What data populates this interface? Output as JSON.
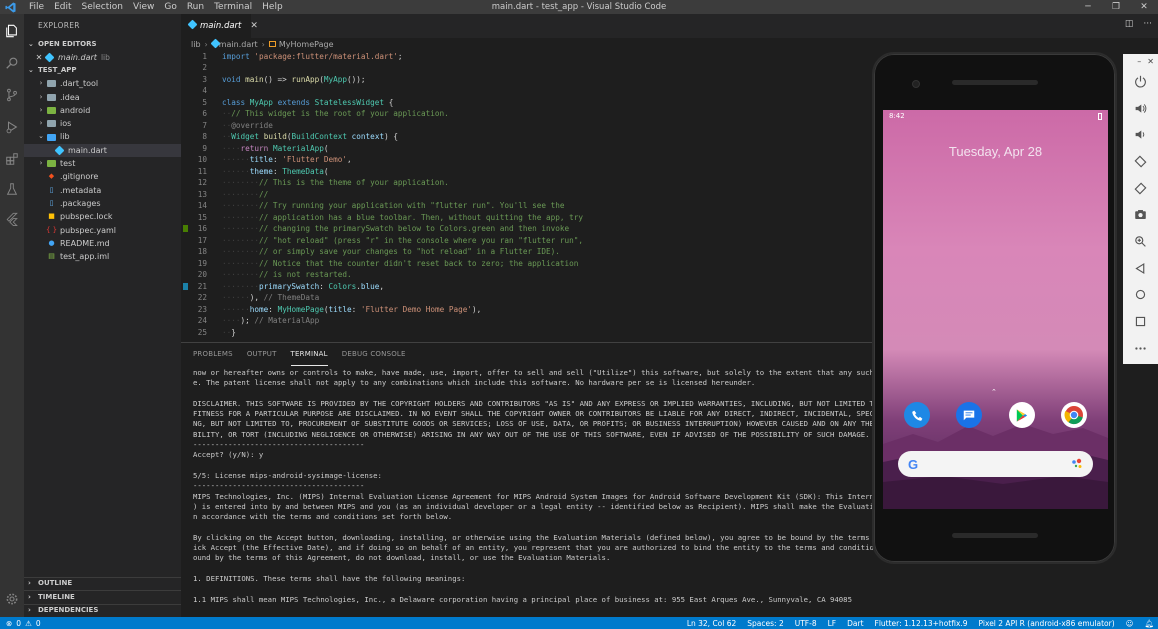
{
  "titlebar": {
    "menu": [
      "File",
      "Edit",
      "Selection",
      "View",
      "Go",
      "Run",
      "Terminal",
      "Help"
    ],
    "title": "main.dart - test_app - Visual Studio Code"
  },
  "sidebar": {
    "header": "EXPLORER",
    "open_editors_title": "OPEN EDITORS",
    "open_editor": {
      "name": "main.dart",
      "folder": "lib"
    },
    "project_title": "TEST_APP",
    "tree": [
      {
        "label": ".dart_tool",
        "indent": 1,
        "kind": "folder",
        "chevron": "›"
      },
      {
        "label": ".idea",
        "indent": 1,
        "kind": "folder",
        "chevron": "›"
      },
      {
        "label": "android",
        "indent": 1,
        "kind": "folder-g",
        "chevron": "›"
      },
      {
        "label": "ios",
        "indent": 1,
        "kind": "folder",
        "chevron": "›"
      },
      {
        "label": "lib",
        "indent": 1,
        "kind": "folder-b",
        "chevron": "⌄"
      },
      {
        "label": "main.dart",
        "indent": 2,
        "kind": "dart",
        "chevron": "",
        "selected": true
      },
      {
        "label": "test",
        "indent": 1,
        "kind": "folder-g",
        "chevron": "›"
      },
      {
        "label": ".gitignore",
        "indent": 1,
        "kind": "git",
        "chevron": ""
      },
      {
        "label": ".metadata",
        "indent": 1,
        "kind": "file",
        "chevron": ""
      },
      {
        "label": ".packages",
        "indent": 1,
        "kind": "file",
        "chevron": ""
      },
      {
        "label": "pubspec.lock",
        "indent": 1,
        "kind": "lock",
        "chevron": ""
      },
      {
        "label": "pubspec.yaml",
        "indent": 1,
        "kind": "yaml",
        "chevron": ""
      },
      {
        "label": "README.md",
        "indent": 1,
        "kind": "info",
        "chevron": ""
      },
      {
        "label": "test_app.iml",
        "indent": 1,
        "kind": "iml",
        "chevron": ""
      }
    ],
    "bottom_sections": [
      "OUTLINE",
      "TIMELINE",
      "DEPENDENCIES"
    ]
  },
  "editor": {
    "tab_label": "main.dart",
    "breadcrumb": [
      "lib",
      "main.dart",
      "MyHomePage"
    ],
    "lines": [
      {
        "n": "1",
        "html": "<span class='kw'>import</span> <span class='st'>'package:flutter/material.dart'</span><span class='pl'>;</span>"
      },
      {
        "n": "2",
        "html": ""
      },
      {
        "n": "3",
        "html": "<span class='kw'>void</span> <span class='fn'>main</span><span class='pl'>() =&gt; </span><span class='fn'>runApp</span><span class='pl'>(</span><span class='ty'>MyApp</span><span class='pl'>());</span>"
      },
      {
        "n": "4",
        "html": ""
      },
      {
        "n": "5",
        "html": "<span class='kw'>class</span> <span class='ty'>MyApp</span> <span class='kw'>extends</span> <span class='ty'>StatelessWidget</span> <span class='pl'>{</span>"
      },
      {
        "n": "6",
        "html": "<span class='ws'>··</span><span class='cm'>// This widget is the root of your application.</span>"
      },
      {
        "n": "7",
        "html": "<span class='ws'>··</span><span class='an'>@override</span>"
      },
      {
        "n": "8",
        "html": "<span class='ws'>··</span><span class='ty'>Widget</span> <span class='fn'>build</span><span class='pl'>(</span><span class='ty'>BuildContext</span> <span class='pr'>context</span><span class='pl'>) {</span>"
      },
      {
        "n": "9",
        "html": "<span class='ws'>····</span><span class='kw2'>return</span> <span class='ty'>MaterialApp</span><span class='pl'>(</span>"
      },
      {
        "n": "10",
        "html": "<span class='ws'>······</span><span class='pr'>title</span><span class='pl'>: </span><span class='st'>'Flutter Demo'</span><span class='pl'>,</span>"
      },
      {
        "n": "11",
        "html": "<span class='ws'>······</span><span class='pr'>theme</span><span class='pl'>: </span><span class='ty'>ThemeData</span><span class='pl'>(</span>"
      },
      {
        "n": "12",
        "html": "<span class='ws'>········</span><span class='cm'>// This is the theme of your application.</span>"
      },
      {
        "n": "13",
        "html": "<span class='ws'>········</span><span class='cm'>//</span>"
      },
      {
        "n": "14",
        "html": "<span class='ws'>········</span><span class='cm'>// Try running your application with \"flutter run\". You'll see the</span>"
      },
      {
        "n": "15",
        "html": "<span class='ws'>········</span><span class='cm'>// application has a blue toolbar. Then, without quitting the app, try</span>"
      },
      {
        "n": "16",
        "html": "<span class='ws'>········</span><span class='cm'>// changing the primarySwatch below to Colors.green and then invoke</span>",
        "gutter": "#487e02"
      },
      {
        "n": "17",
        "html": "<span class='ws'>········</span><span class='cm'>// \"hot reload\" (press \"r\" in the console where you ran \"flutter run\",</span>"
      },
      {
        "n": "18",
        "html": "<span class='ws'>········</span><span class='cm'>// or simply save your changes to \"hot reload\" in a Flutter IDE).</span>"
      },
      {
        "n": "19",
        "html": "<span class='ws'>········</span><span class='cm'>// Notice that the counter didn't reset back to zero; the application</span>"
      },
      {
        "n": "20",
        "html": "<span class='ws'>········</span><span class='cm'>// is not restarted.</span>"
      },
      {
        "n": "21",
        "html": "<span class='ws'>········</span><span class='pr'>primarySwatch</span><span class='pl'>: </span><span class='ty'>Colors</span><span class='pl'>.</span><span class='pr'>blue</span><span class='pl'>,</span>",
        "gutter": "#1b81a8"
      },
      {
        "n": "22",
        "html": "<span class='ws'>······</span><span class='pl'>), </span><span class='an'>// ThemeData</span>"
      },
      {
        "n": "23",
        "html": "<span class='ws'>······</span><span class='pr'>home</span><span class='pl'>: </span><span class='ty'>MyHomePage</span><span class='pl'>(</span><span class='pr'>title</span><span class='pl'>: </span><span class='st'>'Flutter Demo Home Page'</span><span class='pl'>),</span>"
      },
      {
        "n": "24",
        "html": "<span class='ws'>····</span><span class='pl'>); </span><span class='an'>// MaterialApp</span>"
      },
      {
        "n": "25",
        "html": "<span class='ws'>··</span><span class='pl'>}</span>"
      }
    ]
  },
  "panel": {
    "tabs": [
      "PROBLEMS",
      "OUTPUT",
      "TERMINAL",
      "DEBUG CONSOLE"
    ],
    "active_tab": "TERMINAL",
    "terminal_text": "now or hereafter owns or controls to make, have made, use, import, offer to sell and sell (\"Utilize\") this software, but solely to the extent that any such pat\ne. The patent license shall not apply to any combinations which include this software. No hardware per se is licensed hereunder.\n\nDISCLAIMER. THIS SOFTWARE IS PROVIDED BY THE COPYRIGHT HOLDERS AND CONTRIBUTORS \"AS IS\" AND ANY EXPRESS OR IMPLIED WARRANTIES, INCLUDING, BUT NOT LIMITED TO, TH\nFITNESS FOR A PARTICULAR PURPOSE ARE DISCLAIMED. IN NO EVENT SHALL THE COPYRIGHT OWNER OR CONTRIBUTORS BE LIABLE FOR ANY DIRECT, INDIRECT, INCIDENTAL, SPECIAL, \nNG, BUT NOT LIMITED TO, PROCUREMENT OF SUBSTITUTE GOODS OR SERVICES; LOSS OF USE, DATA, OR PROFITS; OR BUSINESS INTERRUPTION) HOWEVER CAUSED AND ON ANY THEORY O\nBILITY, OR TORT (INCLUDING NEGLIGENCE OR OTHERWISE) ARISING IN ANY WAY OUT OF THE USE OF THIS SOFTWARE, EVEN IF ADVISED OF THE POSSIBILITY OF SUCH DAMAGE.\n---------------------------------------\nAccept? (y/N): y\n\n5/5: License mips-android-sysimage-license:\n---------------------------------------\nMIPS Technologies, Inc. (MIPS) Internal Evaluation License Agreement for MIPS Android System Images for Android Software Development Kit (SDK): This Internal Ev\n) is entered into by and between MIPS and you (as an individual developer or a legal entity -- identified below as Recipient). MIPS shall make the Evaluation So\nn accordance with the terms and conditions set forth below.\n\nBy clicking on the Accept button, downloading, installing, or otherwise using the Evaluation Materials (defined below), you agree to be bound by the terms of th\nick Accept (the Effective Date), and if doing so on behalf of an entity, you represent that you are authorized to bind the entity to the terms and conditions o\nound by the terms of this Agreement, do not download, install, or use the Evaluation Materials.\n\n1. DEFINITIONS. These terms shall have the following meanings:\n\n1.1 MIPS shall mean MIPS Technologies, Inc., a Delaware corporation having a principal place of business at: 955 East Arques Ave., Sunnyvale, CA 94085"
  },
  "emulator": {
    "time": "8:42",
    "date": "Tuesday, Apr 28"
  },
  "statusbar": {
    "errors": "0",
    "warnings": "0",
    "position": "Ln 32, Col 62",
    "spaces": "Spaces: 2",
    "encoding": "UTF-8",
    "eol": "LF",
    "language": "Dart",
    "flutter": "Flutter: 1.12.13+hotfix.9",
    "device": "Pixel 2 API R (android-x86 emulator)"
  }
}
